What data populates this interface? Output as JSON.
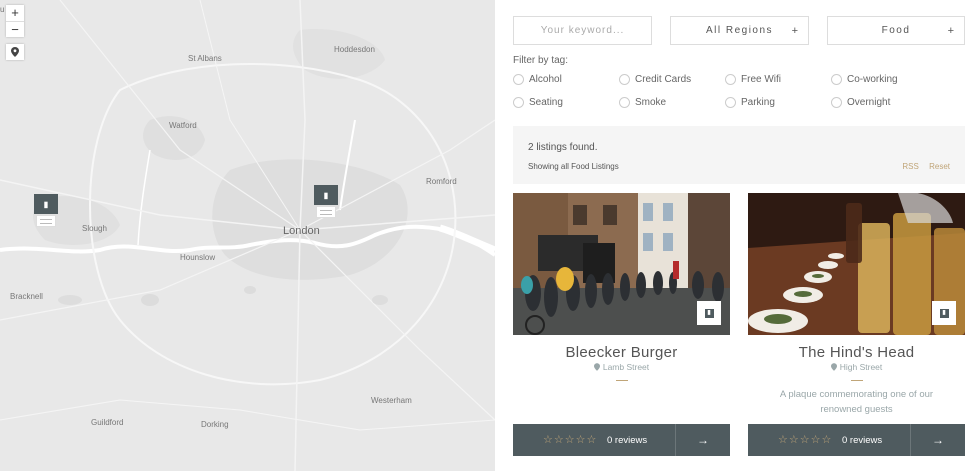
{
  "map": {
    "corner_fragment": "u",
    "zoom_in": "+",
    "zoom_out": "−",
    "places": {
      "st_albans": "St Albans",
      "hoddesdon": "Hoddesdon",
      "watford": "Watford",
      "romford": "Romford",
      "slough": "Slough",
      "london": "London",
      "hounslow": "Hounslow",
      "bracknell": "Bracknell",
      "westerham": "Westerham",
      "guildford": "Guildford",
      "dorking": "Dorking"
    },
    "marker_glyph": "▮"
  },
  "search": {
    "keyword_placeholder": "Your keyword...",
    "region_label": "All Regions",
    "category_label": "Food",
    "plus": "+"
  },
  "filters": {
    "title": "Filter by tag:",
    "tags": [
      "Alcohol",
      "Credit Cards",
      "Free Wifi",
      "Co-working",
      "Seating",
      "Smoke",
      "Parking",
      "Overnight"
    ]
  },
  "results": {
    "count": "2 listings found.",
    "showing": "Showing all Food Listings",
    "rss": "RSS",
    "reset": "Reset"
  },
  "listings": [
    {
      "title": "Bleecker Burger",
      "address": "Lamb Street",
      "description": "",
      "stars": "☆☆☆☆☆",
      "reviews": "0 reviews",
      "arrow": "→"
    },
    {
      "title": "The Hind's Head",
      "address": "High Street",
      "description": "A plaque commemorating one of our renowned guests",
      "stars": "☆☆☆☆☆",
      "reviews": "0 reviews",
      "arrow": "→"
    }
  ],
  "colors": {
    "accent": "#c0a578",
    "dark": "#4f5b5f",
    "map_bg": "#e9e9e9"
  }
}
